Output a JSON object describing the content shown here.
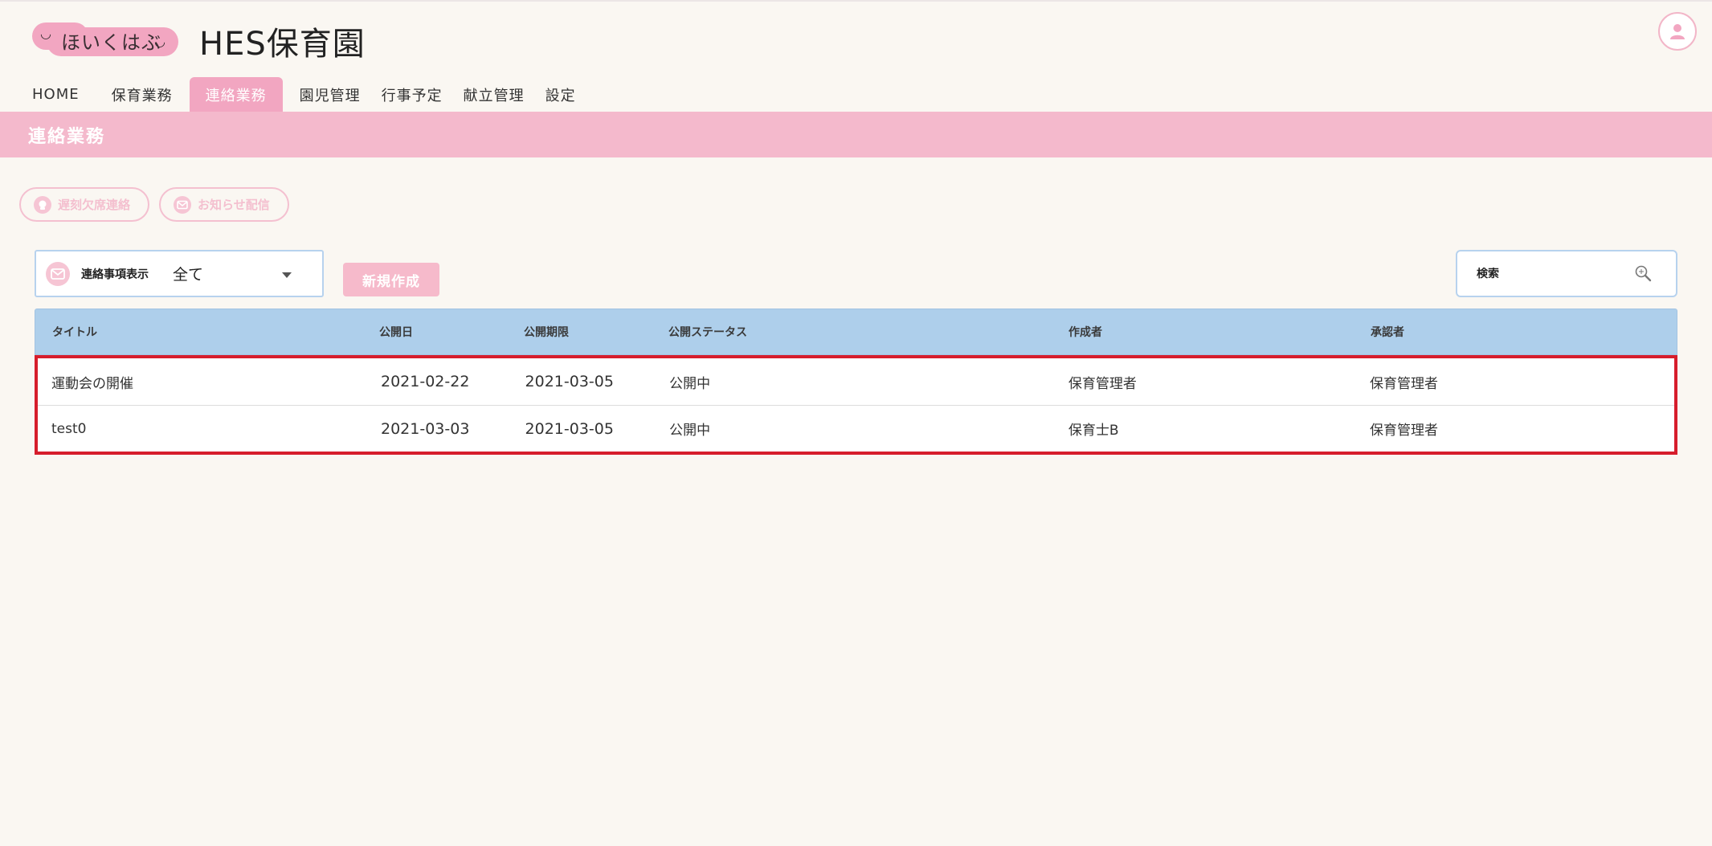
{
  "header": {
    "logo_text": "ほいくはぶ",
    "site_title": "HES保育園"
  },
  "nav": {
    "items": [
      {
        "label": "HOME"
      },
      {
        "label": "保育業務"
      },
      {
        "label": "連絡業務"
      },
      {
        "label": "園児管理"
      },
      {
        "label": "行事予定"
      },
      {
        "label": "献立管理"
      },
      {
        "label": "設定"
      }
    ],
    "active_index": 2
  },
  "page": {
    "title": "連絡業務"
  },
  "actions": {
    "late_absence_label": "遅刻欠席連絡",
    "notice_label": "お知らせ配信"
  },
  "filter": {
    "label": "連絡事項表示",
    "value": "全て"
  },
  "new_button_label": "新規作成",
  "search": {
    "placeholder": "検索"
  },
  "table": {
    "headers": [
      "タイトル",
      "公開日",
      "公開期限",
      "公開ステータス",
      "作成者",
      "承認者"
    ],
    "rows": [
      [
        "運動会の開催",
        "2021-02-22",
        "2021-03-05",
        "公開中",
        "保育管理者",
        "保育管理者"
      ],
      [
        "test0",
        "2021-03-03",
        "2021-03-05",
        "公開中",
        "保育士B",
        "保育管理者"
      ]
    ]
  },
  "colors": {
    "brand_pink": "#f2a6c1",
    "header_band": "#f4b9cc",
    "table_header": "#aecfeb",
    "highlight_border": "#d61d2c"
  }
}
